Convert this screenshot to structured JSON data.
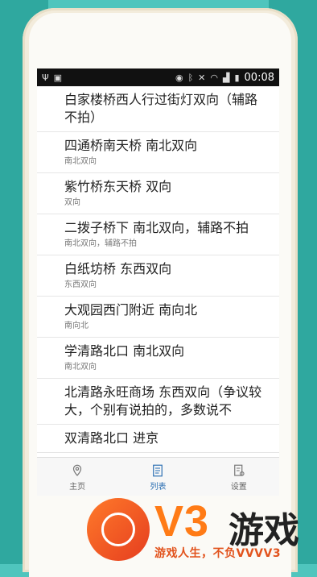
{
  "status_bar": {
    "time": "00:08",
    "icons": [
      "usb-icon",
      "sim-icon",
      "eye-icon",
      "bluetooth-icon",
      "mute-icon",
      "wifi-icon",
      "signal-icon",
      "battery-icon"
    ]
  },
  "list": [
    {
      "title": "白家楼桥西人行过街灯双向（辅路不拍）",
      "subtitle": ""
    },
    {
      "title": "四通桥南天桥 南北双向",
      "subtitle": "南北双向"
    },
    {
      "title": "紫竹桥东天桥 双向",
      "subtitle": "双向"
    },
    {
      "title": "二拨子桥下 南北双向，辅路不拍",
      "subtitle": "南北双向，辅路不拍"
    },
    {
      "title": "白纸坊桥 东西双向",
      "subtitle": "东西双向"
    },
    {
      "title": "大观园西门附近 南向北",
      "subtitle": "南向北"
    },
    {
      "title": "学清路北口 南北双向",
      "subtitle": "南北双向"
    },
    {
      "title": "北清路永旺商场 东西双向（争议较大，个别有说拍的，多数说不",
      "subtitle": ""
    },
    {
      "title": "双清路北口 进京",
      "subtitle": ""
    }
  ],
  "tabs": [
    {
      "label": "主页",
      "icon": "home-pin-icon"
    },
    {
      "label": "列表",
      "icon": "list-icon"
    },
    {
      "label": "设置",
      "icon": "settings-doc-icon"
    }
  ],
  "brand": {
    "logo_text": "V3",
    "logo_text2": "游戏",
    "slogan": "游戏人生，不负VVVV3",
    "accent_color": "#ff7b16"
  }
}
